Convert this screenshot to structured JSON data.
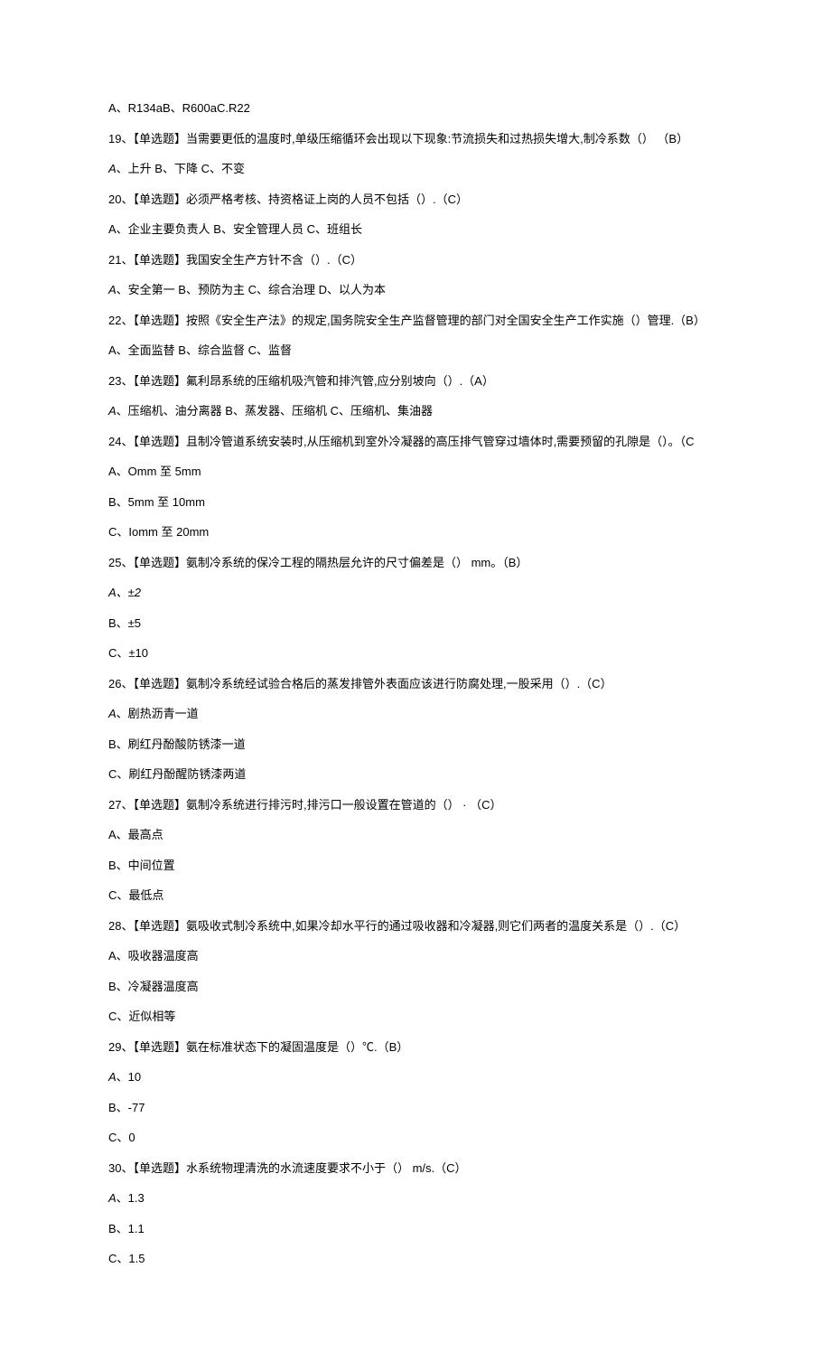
{
  "lines": [
    {
      "text": "A、R134aB、R600aC.R22"
    },
    {
      "text": "19、【单选题】当需要更低的温度时,单级压缩循环会出现以下现象:节流损失和过热损失增大,制冷系数（） （B）"
    },
    {
      "text": "A、上升 B、下降 C、不变",
      "italicPrefix": "A"
    },
    {
      "text": "20、【单选题】必须严格考核、持资格证上岗的人员不包括（）.（C）"
    },
    {
      "text": "A、企业主要负责人 B、安全管理人员 C、班组长"
    },
    {
      "text": "21、【单选题】我国安全生产方针不含（）.（C）"
    },
    {
      "text": "A、安全第一 B、预防为主 C、综合治理 D、以人为本",
      "italicPrefix": "A"
    },
    {
      "text": "22、【单选题】按照《安全生产法》的规定,国务院安全生产监督管理的部门对全国安全生产工作实施（）管理.（B）"
    },
    {
      "text": "A、全面监替 B、综合监督 C、监督"
    },
    {
      "text": "23、【单选题】氟利昂系统的压缩机吸汽管和排汽管,应分别坡向（）.（A）"
    },
    {
      "text": "A、压缩机、油分离器 B、蒸发器、压缩机 C、压缩机、集油器",
      "italicPrefix": "A"
    },
    {
      "text": "24、【单选题】且制冷管道系统安装时,从压缩机到室外冷凝器的高压排气管穿过墙体时,需要预留的孔隙是（）。（C"
    },
    {
      "text": "A、Omm 至 5mm"
    },
    {
      "text": "B、5mm 至 10mm"
    },
    {
      "text": "C、Iomm 至 20mm"
    },
    {
      "text": "25、【单选题】氨制冷系统的保冷工程的隔热层允许的尺寸偏差是（） mm。（B）"
    },
    {
      "text": "A、±2",
      "italicPrefix": "A、±2"
    },
    {
      "text": "B、±5"
    },
    {
      "text": "C、±10"
    },
    {
      "text": "26、【单选题】氨制冷系统经试验合格后的蒸发排管外表面应该进行防腐处理,一股采用（）.（C）"
    },
    {
      "text": "A、剧热沥青一道",
      "italicPrefix": "A"
    },
    {
      "text": "B、刷红丹酚酸防锈漆一道"
    },
    {
      "text": "C、刷红丹酚醒防锈漆两道"
    },
    {
      "text": "27、【单选题】氨制冷系统进行排污时,排污口一般设置在管道的（） · （C）"
    },
    {
      "text": "A、最高点"
    },
    {
      "text": "B、中间位置"
    },
    {
      "text": "C、最低点"
    },
    {
      "text": "28、【单选题】氨吸收式制冷系统中,如果冷却水平行的通过吸收器和冷凝器,则它们两者的温度关系是（）.（C）"
    },
    {
      "text": "A、吸收器温度高"
    },
    {
      "text": "B、冷凝器温度高"
    },
    {
      "text": "C、近似相等"
    },
    {
      "text": "29、【单选题】氨在标准状态下的凝固温度是（）℃.（B）"
    },
    {
      "text": "A、10",
      "italicPrefix": "A"
    },
    {
      "text": "B、-77"
    },
    {
      "text": "C、0"
    },
    {
      "text": "30、【单选题】水系统物理清洗的水流速度要求不小于（） m/s.（C）"
    },
    {
      "text": "A、1.3",
      "italicPrefix": "A"
    },
    {
      "text": "B、1.1"
    },
    {
      "text": "C、1.5"
    }
  ]
}
